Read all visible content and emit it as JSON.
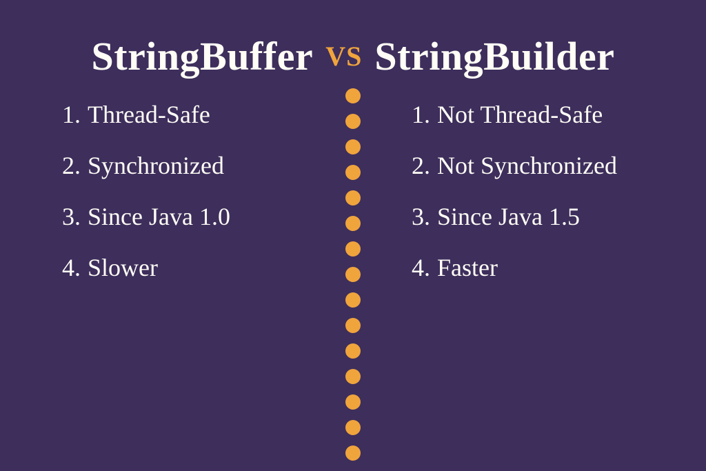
{
  "header": {
    "left_title": "StringBuffer",
    "vs": "VS",
    "right_title": "StringBuilder"
  },
  "left": {
    "items": [
      {
        "num": "1.",
        "text": " Thread-Safe"
      },
      {
        "num": "2.",
        "text": "Synchronized"
      },
      {
        "num": "3.",
        "text": "Since Java 1.0"
      },
      {
        "num": "4.",
        "text": "Slower"
      }
    ]
  },
  "right": {
    "items": [
      {
        "num": "1.",
        "text": "Not Thread-Safe"
      },
      {
        "num": "2.",
        "text": "Not Synchronized"
      },
      {
        "num": "3.",
        "text": "Since Java 1.5"
      },
      {
        "num": "4.",
        "text": "Faster"
      }
    ]
  },
  "colors": {
    "background": "#3d2e5c",
    "text": "#fffdf5",
    "accent": "#f0a43c"
  },
  "divider": {
    "dot_count": 15
  }
}
